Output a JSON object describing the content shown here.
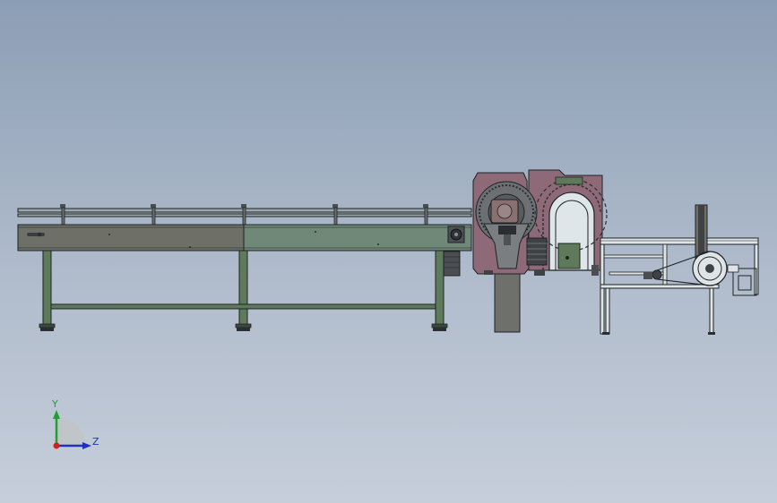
{
  "viewport": {
    "name": "cad-graphics-area",
    "background_top": "#8c9eb5",
    "background_bottom": "#c6ceda"
  },
  "colors": {
    "frame_green": "#5f7a5a",
    "panel_green": "#6f8878",
    "panel_dark": "#6e7068",
    "housing_mauve": "#8e6a78",
    "column_gray": "#6e706c",
    "line_dark": "#1e2224",
    "axis_x": "#d02020",
    "axis_y": "#20a030",
    "axis_z": "#2030c0"
  },
  "triad": {
    "y_label": "Y",
    "z_label": "Z"
  }
}
